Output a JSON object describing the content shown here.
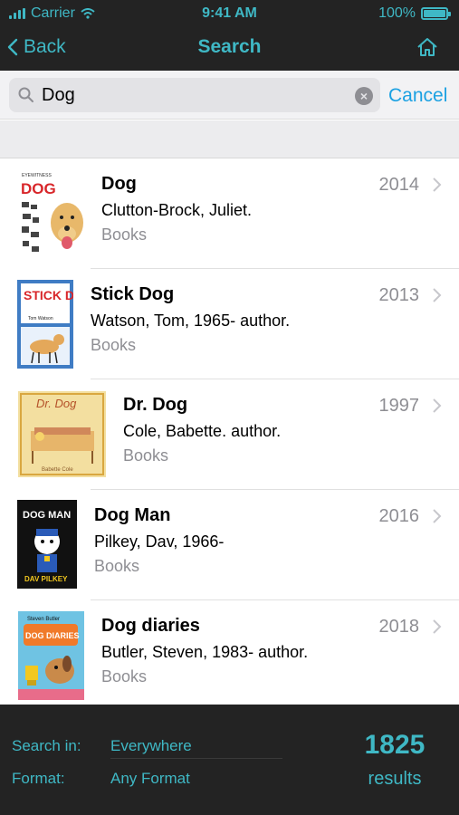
{
  "status": {
    "carrier": "Carrier",
    "time": "9:41 AM",
    "battery": "100%"
  },
  "nav": {
    "back_label": "Back",
    "title": "Search"
  },
  "search": {
    "query": "Dog",
    "cancel_label": "Cancel"
  },
  "results": [
    {
      "title": "Dog",
      "author": "Clutton-Brock, Juliet.",
      "format": "Books",
      "year": "2014",
      "cover_text": "DOG",
      "cover_top": "EYEWITNESS"
    },
    {
      "title": "Stick Dog",
      "author": "Watson, Tom, 1965- author.",
      "format": "Books",
      "year": "2013",
      "cover_text": "STICK DOG",
      "cover_top": "Tom Watson"
    },
    {
      "title": "Dr. Dog",
      "author": "Cole, Babette. author.",
      "format": "Books",
      "year": "1997",
      "cover_text": "Dr. Dog",
      "cover_top": "Babette Cole"
    },
    {
      "title": "Dog Man",
      "author": "Pilkey, Dav, 1966-",
      "format": "Books",
      "year": "2016",
      "cover_text": "DOG MAN",
      "cover_top": "DAV PILKEY"
    },
    {
      "title": "Dog diaries",
      "author": "Butler, Steven, 1983- author.",
      "format": "Books",
      "year": "2018",
      "cover_text": "DOG DIARIES",
      "cover_top": "Steven Butler"
    }
  ],
  "footer": {
    "search_in_label": "Search in:",
    "search_in_value": "Everywhere",
    "format_label": "Format:",
    "format_value": "Any Format",
    "count": "1825",
    "count_label": "results"
  },
  "colors": {
    "accent": "#3fb8c5",
    "link": "#1ba1e2",
    "bar_bg": "#232323"
  }
}
